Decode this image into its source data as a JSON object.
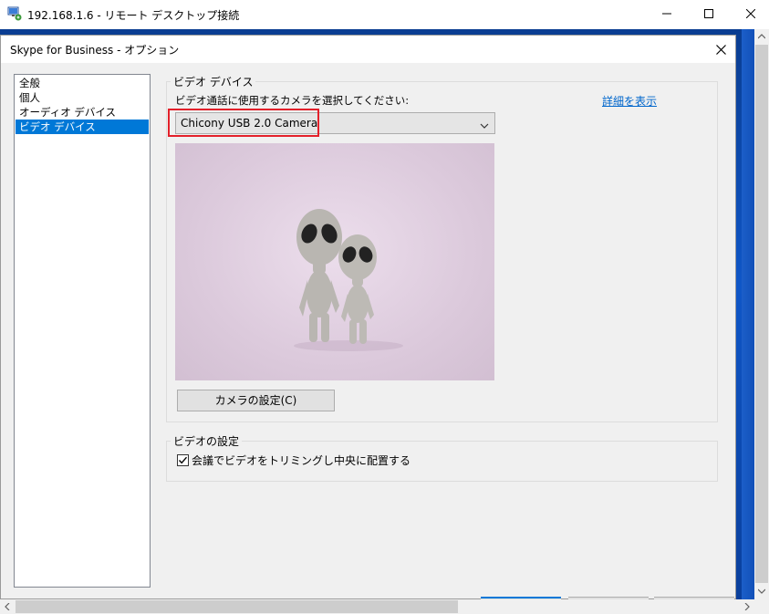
{
  "rdp_window": {
    "title": "192.168.1.6 - リモート デスクトップ接続",
    "icon": "remote-desktop-icon"
  },
  "dialog": {
    "title": "Skype for Business - オプション"
  },
  "nav": {
    "items": [
      {
        "label": "全般",
        "selected": false
      },
      {
        "label": "個人",
        "selected": false
      },
      {
        "label": "オーディオ デバイス",
        "selected": false
      },
      {
        "label": "ビデオ デバイス",
        "selected": true
      }
    ]
  },
  "video_device": {
    "group_label": "ビデオ デバイス",
    "prompt": "ビデオ通話に使用するカメラを選択してください:",
    "details_link": "詳細を表示",
    "camera_select_value": "Chicony USB 2.0 Camera",
    "camera_settings_button": "カメラの設定(C)"
  },
  "video_settings": {
    "group_label": "ビデオの設定",
    "trim_checkbox_label": "会議でビデオをトリミングし中央に配置する",
    "trim_checked": true
  },
  "colors": {
    "selection": "#0078d7",
    "link": "#0066cc",
    "highlight": "#e3202a",
    "dialog_bg": "#f0f0f0"
  }
}
